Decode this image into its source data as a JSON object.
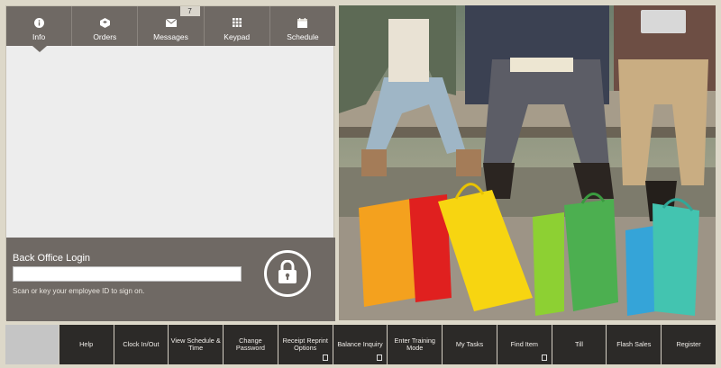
{
  "tabs": [
    {
      "label": "Info",
      "icon": "info-icon"
    },
    {
      "label": "Orders",
      "icon": "orders-icon"
    },
    {
      "label": "Messages",
      "icon": "envelope-icon"
    },
    {
      "label": "Keypad",
      "icon": "keypad-icon"
    },
    {
      "label": "Schedule",
      "icon": "schedule-icon"
    }
  ],
  "messages_count": "7",
  "login": {
    "title": "Back Office Login",
    "input_value": "",
    "hint": "Scan or key your employee ID to sign on."
  },
  "function_keys": [
    {
      "label": "Help"
    },
    {
      "label": "Clock In/Out"
    },
    {
      "label": "View Schedule & Time"
    },
    {
      "label": "Change Password"
    },
    {
      "label": "Receipt Reprint Options",
      "has_doc_icon": true
    },
    {
      "label": "Balance Inquiry",
      "has_doc_icon": true
    },
    {
      "label": "Enter Training Mode"
    },
    {
      "label": "My Tasks"
    },
    {
      "label": "Find Item",
      "has_doc_icon": true
    },
    {
      "label": "Till"
    },
    {
      "label": "Flash Sales"
    },
    {
      "label": "Register"
    }
  ],
  "colors": {
    "panel": "#6f6964",
    "background": "#ddd8c9",
    "function_key": "#2c2a28"
  }
}
